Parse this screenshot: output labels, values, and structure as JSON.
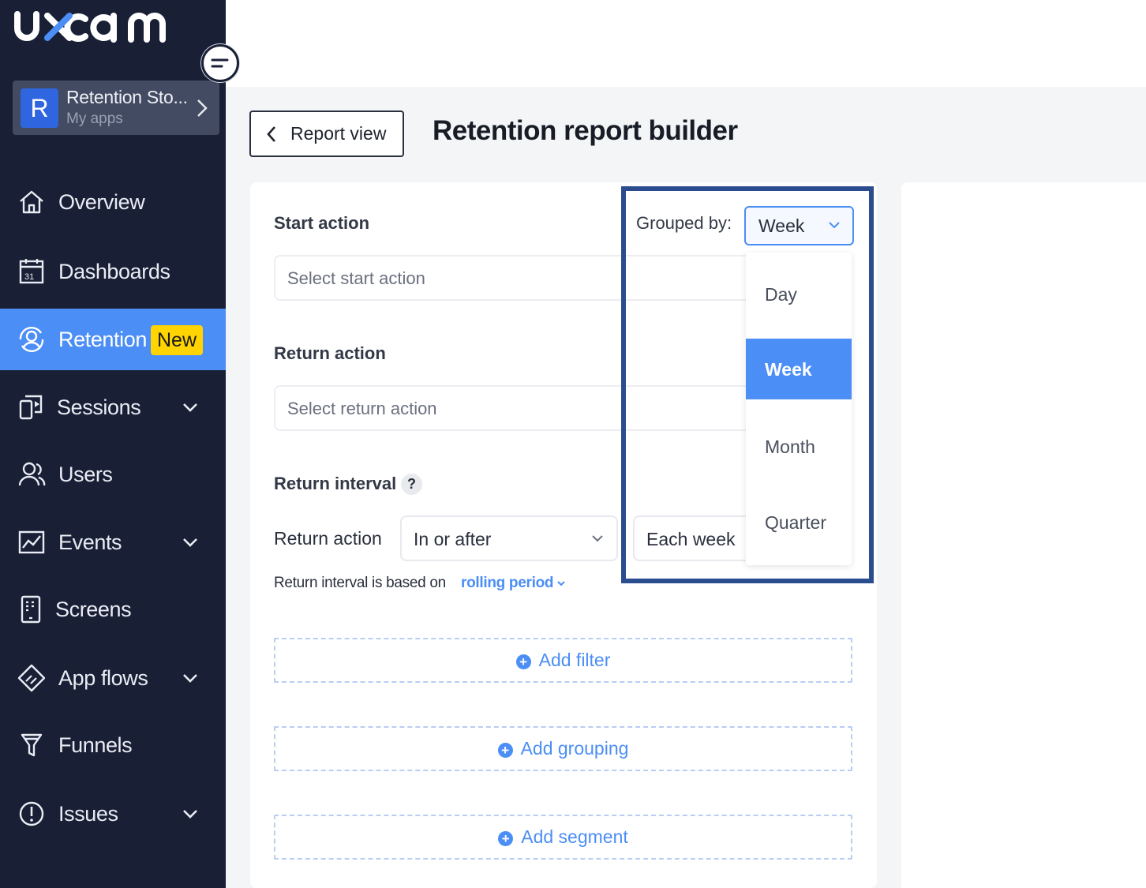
{
  "brand": {
    "logo_text": "uxcam",
    "accent": "#4b8ef5",
    "sidebar_bg": "#192036",
    "highlight_border": "#2b4d8f"
  },
  "app_switcher": {
    "avatar_letter": "R",
    "name": "Retention Sto...",
    "subtitle": "My apps"
  },
  "nav": {
    "items": [
      {
        "label": "Overview",
        "icon": "home-icon"
      },
      {
        "label": "Dashboards",
        "icon": "calendar-icon"
      },
      {
        "label": "Retention",
        "icon": "retention-icon",
        "badge": "New",
        "active": true
      },
      {
        "label": "Sessions",
        "icon": "session-replay-icon",
        "expandable": true
      },
      {
        "label": "Users",
        "icon": "users-icon"
      },
      {
        "label": "Events",
        "icon": "events-chart-icon",
        "expandable": true
      },
      {
        "label": "Screens",
        "icon": "phone-screen-icon"
      },
      {
        "label": "App flows",
        "icon": "app-flows-icon",
        "expandable": true
      },
      {
        "label": "Funnels",
        "icon": "funnel-icon"
      },
      {
        "label": "Issues",
        "icon": "alert-circle-icon",
        "expandable": true
      }
    ]
  },
  "header": {
    "back_label": "Report view",
    "title": "Retention report builder"
  },
  "builder": {
    "start_action": {
      "label": "Start action",
      "placeholder": "Select start action"
    },
    "return_action": {
      "label": "Return action",
      "placeholder": "Select return action"
    },
    "return_interval": {
      "label": "Return interval",
      "help": "?",
      "row_label": "Return action",
      "condition": "In or after",
      "period": "Each week",
      "note": "Return interval is based on",
      "link": "rolling period"
    },
    "add_filter": "Add filter",
    "add_grouping": "Add grouping",
    "add_segment": "Add segment"
  },
  "grouped_by": {
    "label": "Grouped by:",
    "selected": "Week",
    "options": [
      "Day",
      "Week",
      "Month",
      "Quarter"
    ]
  }
}
